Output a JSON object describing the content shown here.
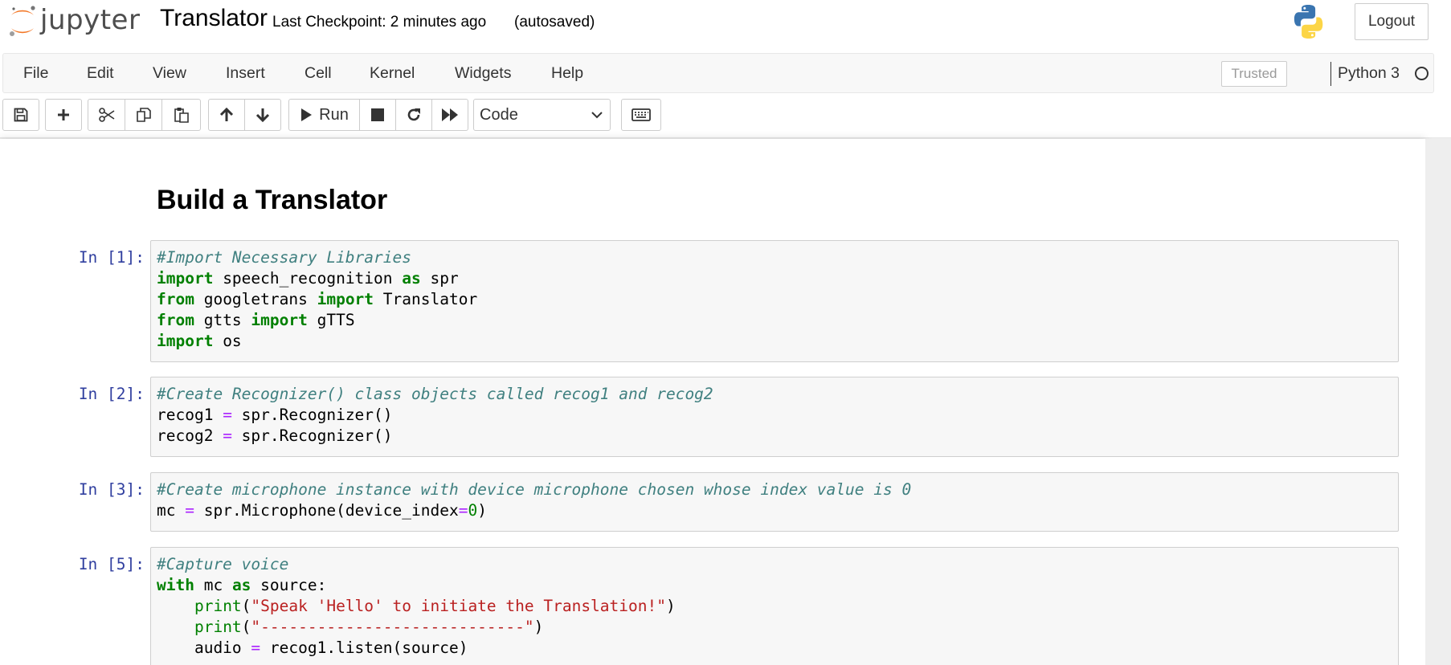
{
  "header": {
    "logo_text": "jupyter",
    "notebook_title": "Translator",
    "checkpoint": "Last Checkpoint: 2 minutes ago",
    "autosave_status": "(autosaved)",
    "logout_label": "Logout"
  },
  "menubar": {
    "items": [
      "File",
      "Edit",
      "View",
      "Insert",
      "Cell",
      "Kernel",
      "Widgets",
      "Help"
    ],
    "trusted_label": "Trusted",
    "kernel_name": "Python 3"
  },
  "toolbar": {
    "run_label": "Run",
    "cell_type": "Code",
    "cell_type_options": [
      "Code"
    ]
  },
  "notebook": {
    "heading": "Build a Translator",
    "cells": [
      {
        "prompt": "In [1]:",
        "lines": [
          [
            {
              "t": "#Import Necessary Libraries",
              "c": "cm"
            }
          ],
          [
            {
              "t": "import",
              "c": "kw"
            },
            {
              "t": " speech_recognition "
            },
            {
              "t": "as",
              "c": "kw"
            },
            {
              "t": " spr"
            }
          ],
          [
            {
              "t": "from",
              "c": "kw"
            },
            {
              "t": " googletrans "
            },
            {
              "t": "import",
              "c": "kw"
            },
            {
              "t": " Translator"
            }
          ],
          [
            {
              "t": "from",
              "c": "kw"
            },
            {
              "t": " gtts "
            },
            {
              "t": "import",
              "c": "kw"
            },
            {
              "t": " gTTS"
            }
          ],
          [
            {
              "t": "import",
              "c": "kw"
            },
            {
              "t": " os"
            }
          ]
        ]
      },
      {
        "prompt": "In [2]:",
        "lines": [
          [
            {
              "t": "#Create Recognizer() class objects called recog1 and recog2",
              "c": "cm"
            }
          ],
          [
            {
              "t": "recog1 "
            },
            {
              "t": "=",
              "c": "op"
            },
            {
              "t": " spr.Recognizer()"
            }
          ],
          [
            {
              "t": "recog2 "
            },
            {
              "t": "=",
              "c": "op"
            },
            {
              "t": " spr.Recognizer()"
            }
          ]
        ]
      },
      {
        "prompt": "In [3]:",
        "lines": [
          [
            {
              "t": "#Create microphone instance with device microphone chosen whose index value is 0",
              "c": "cm"
            }
          ],
          [
            {
              "t": "mc "
            },
            {
              "t": "=",
              "c": "op"
            },
            {
              "t": " spr.Microphone(device_index"
            },
            {
              "t": "=",
              "c": "op"
            },
            {
              "t": "0",
              "c": "nm"
            },
            {
              "t": ")"
            }
          ]
        ]
      },
      {
        "prompt": "In [5]:",
        "lines": [
          [
            {
              "t": "#Capture voice",
              "c": "cm"
            }
          ],
          [
            {
              "t": "with",
              "c": "kw"
            },
            {
              "t": " mc "
            },
            {
              "t": "as",
              "c": "kw"
            },
            {
              "t": " source:"
            }
          ],
          [
            {
              "t": "    "
            },
            {
              "t": "print",
              "c": "bi"
            },
            {
              "t": "("
            },
            {
              "t": "\"Speak 'Hello' to initiate the Translation!\"",
              "c": "st"
            },
            {
              "t": ")"
            }
          ],
          [
            {
              "t": "    "
            },
            {
              "t": "print",
              "c": "bi"
            },
            {
              "t": "("
            },
            {
              "t": "\"----------------------------\"",
              "c": "st"
            },
            {
              "t": ")"
            }
          ],
          [
            {
              "t": "    audio "
            },
            {
              "t": "=",
              "c": "op"
            },
            {
              "t": " recog1.listen(source)"
            }
          ]
        ]
      }
    ]
  },
  "colors": {
    "prompt": "#303f9f",
    "comment": "#408080",
    "keyword": "#008000",
    "operator": "#aa22ff",
    "string": "#ba2121",
    "cell_background": "#f7f7f7"
  },
  "icons": {
    "save": "floppy-icon",
    "insert": "plus-icon",
    "cut": "scissors-icon",
    "copy": "copy-icon",
    "paste": "paste-icon",
    "move_up": "arrow-up-icon",
    "move_down": "arrow-down-icon",
    "run": "play-icon",
    "interrupt": "stop-icon",
    "restart": "restart-icon",
    "restart_run_all": "fast-forward-icon",
    "command_palette": "keyboard-icon"
  }
}
